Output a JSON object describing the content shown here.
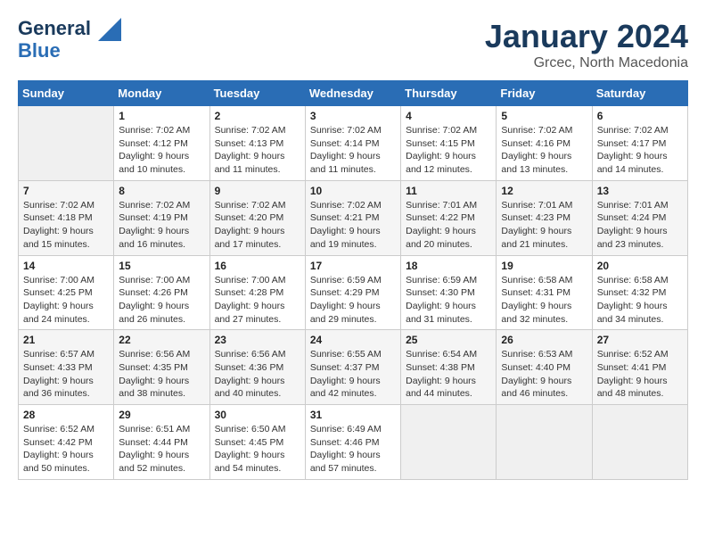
{
  "header": {
    "logo_line1": "General",
    "logo_line2": "Blue",
    "month_title": "January 2024",
    "location": "Grcec, North Macedonia"
  },
  "weekdays": [
    "Sunday",
    "Monday",
    "Tuesday",
    "Wednesday",
    "Thursday",
    "Friday",
    "Saturday"
  ],
  "weeks": [
    [
      {
        "day": "",
        "sunrise": "",
        "sunset": "",
        "daylight": ""
      },
      {
        "day": "1",
        "sunrise": "Sunrise: 7:02 AM",
        "sunset": "Sunset: 4:12 PM",
        "daylight": "Daylight: 9 hours and 10 minutes."
      },
      {
        "day": "2",
        "sunrise": "Sunrise: 7:02 AM",
        "sunset": "Sunset: 4:13 PM",
        "daylight": "Daylight: 9 hours and 11 minutes."
      },
      {
        "day": "3",
        "sunrise": "Sunrise: 7:02 AM",
        "sunset": "Sunset: 4:14 PM",
        "daylight": "Daylight: 9 hours and 11 minutes."
      },
      {
        "day": "4",
        "sunrise": "Sunrise: 7:02 AM",
        "sunset": "Sunset: 4:15 PM",
        "daylight": "Daylight: 9 hours and 12 minutes."
      },
      {
        "day": "5",
        "sunrise": "Sunrise: 7:02 AM",
        "sunset": "Sunset: 4:16 PM",
        "daylight": "Daylight: 9 hours and 13 minutes."
      },
      {
        "day": "6",
        "sunrise": "Sunrise: 7:02 AM",
        "sunset": "Sunset: 4:17 PM",
        "daylight": "Daylight: 9 hours and 14 minutes."
      }
    ],
    [
      {
        "day": "7",
        "sunrise": "Sunrise: 7:02 AM",
        "sunset": "Sunset: 4:18 PM",
        "daylight": "Daylight: 9 hours and 15 minutes."
      },
      {
        "day": "8",
        "sunrise": "Sunrise: 7:02 AM",
        "sunset": "Sunset: 4:19 PM",
        "daylight": "Daylight: 9 hours and 16 minutes."
      },
      {
        "day": "9",
        "sunrise": "Sunrise: 7:02 AM",
        "sunset": "Sunset: 4:20 PM",
        "daylight": "Daylight: 9 hours and 17 minutes."
      },
      {
        "day": "10",
        "sunrise": "Sunrise: 7:02 AM",
        "sunset": "Sunset: 4:21 PM",
        "daylight": "Daylight: 9 hours and 19 minutes."
      },
      {
        "day": "11",
        "sunrise": "Sunrise: 7:01 AM",
        "sunset": "Sunset: 4:22 PM",
        "daylight": "Daylight: 9 hours and 20 minutes."
      },
      {
        "day": "12",
        "sunrise": "Sunrise: 7:01 AM",
        "sunset": "Sunset: 4:23 PM",
        "daylight": "Daylight: 9 hours and 21 minutes."
      },
      {
        "day": "13",
        "sunrise": "Sunrise: 7:01 AM",
        "sunset": "Sunset: 4:24 PM",
        "daylight": "Daylight: 9 hours and 23 minutes."
      }
    ],
    [
      {
        "day": "14",
        "sunrise": "Sunrise: 7:00 AM",
        "sunset": "Sunset: 4:25 PM",
        "daylight": "Daylight: 9 hours and 24 minutes."
      },
      {
        "day": "15",
        "sunrise": "Sunrise: 7:00 AM",
        "sunset": "Sunset: 4:26 PM",
        "daylight": "Daylight: 9 hours and 26 minutes."
      },
      {
        "day": "16",
        "sunrise": "Sunrise: 7:00 AM",
        "sunset": "Sunset: 4:28 PM",
        "daylight": "Daylight: 9 hours and 27 minutes."
      },
      {
        "day": "17",
        "sunrise": "Sunrise: 6:59 AM",
        "sunset": "Sunset: 4:29 PM",
        "daylight": "Daylight: 9 hours and 29 minutes."
      },
      {
        "day": "18",
        "sunrise": "Sunrise: 6:59 AM",
        "sunset": "Sunset: 4:30 PM",
        "daylight": "Daylight: 9 hours and 31 minutes."
      },
      {
        "day": "19",
        "sunrise": "Sunrise: 6:58 AM",
        "sunset": "Sunset: 4:31 PM",
        "daylight": "Daylight: 9 hours and 32 minutes."
      },
      {
        "day": "20",
        "sunrise": "Sunrise: 6:58 AM",
        "sunset": "Sunset: 4:32 PM",
        "daylight": "Daylight: 9 hours and 34 minutes."
      }
    ],
    [
      {
        "day": "21",
        "sunrise": "Sunrise: 6:57 AM",
        "sunset": "Sunset: 4:33 PM",
        "daylight": "Daylight: 9 hours and 36 minutes."
      },
      {
        "day": "22",
        "sunrise": "Sunrise: 6:56 AM",
        "sunset": "Sunset: 4:35 PM",
        "daylight": "Daylight: 9 hours and 38 minutes."
      },
      {
        "day": "23",
        "sunrise": "Sunrise: 6:56 AM",
        "sunset": "Sunset: 4:36 PM",
        "daylight": "Daylight: 9 hours and 40 minutes."
      },
      {
        "day": "24",
        "sunrise": "Sunrise: 6:55 AM",
        "sunset": "Sunset: 4:37 PM",
        "daylight": "Daylight: 9 hours and 42 minutes."
      },
      {
        "day": "25",
        "sunrise": "Sunrise: 6:54 AM",
        "sunset": "Sunset: 4:38 PM",
        "daylight": "Daylight: 9 hours and 44 minutes."
      },
      {
        "day": "26",
        "sunrise": "Sunrise: 6:53 AM",
        "sunset": "Sunset: 4:40 PM",
        "daylight": "Daylight: 9 hours and 46 minutes."
      },
      {
        "day": "27",
        "sunrise": "Sunrise: 6:52 AM",
        "sunset": "Sunset: 4:41 PM",
        "daylight": "Daylight: 9 hours and 48 minutes."
      }
    ],
    [
      {
        "day": "28",
        "sunrise": "Sunrise: 6:52 AM",
        "sunset": "Sunset: 4:42 PM",
        "daylight": "Daylight: 9 hours and 50 minutes."
      },
      {
        "day": "29",
        "sunrise": "Sunrise: 6:51 AM",
        "sunset": "Sunset: 4:44 PM",
        "daylight": "Daylight: 9 hours and 52 minutes."
      },
      {
        "day": "30",
        "sunrise": "Sunrise: 6:50 AM",
        "sunset": "Sunset: 4:45 PM",
        "daylight": "Daylight: 9 hours and 54 minutes."
      },
      {
        "day": "31",
        "sunrise": "Sunrise: 6:49 AM",
        "sunset": "Sunset: 4:46 PM",
        "daylight": "Daylight: 9 hours and 57 minutes."
      },
      {
        "day": "",
        "sunrise": "",
        "sunset": "",
        "daylight": ""
      },
      {
        "day": "",
        "sunrise": "",
        "sunset": "",
        "daylight": ""
      },
      {
        "day": "",
        "sunrise": "",
        "sunset": "",
        "daylight": ""
      }
    ]
  ]
}
